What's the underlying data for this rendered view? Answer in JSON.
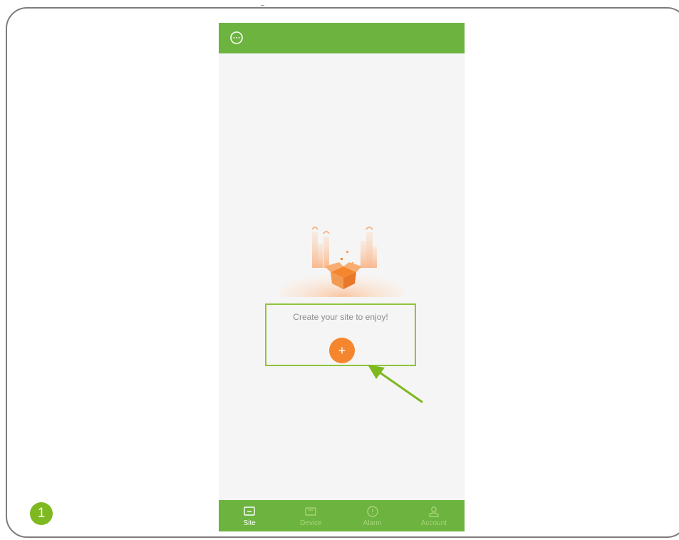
{
  "page": {
    "step_number": "1"
  },
  "header": {
    "menu_icon": "more-icon"
  },
  "empty_state": {
    "message": "Create your site to enjoy!",
    "add_label": "+"
  },
  "bottom_nav": {
    "items": [
      {
        "label": "Site",
        "icon": "site-icon",
        "active": true
      },
      {
        "label": "Device",
        "icon": "device-icon",
        "active": false
      },
      {
        "label": "Alarm",
        "icon": "alarm-icon",
        "active": false
      },
      {
        "label": "Account",
        "icon": "account-icon",
        "active": false
      }
    ]
  },
  "colors": {
    "brand_green": "#6cb33f",
    "accent_orange": "#f5862d",
    "highlight_green": "#8fc43a"
  }
}
